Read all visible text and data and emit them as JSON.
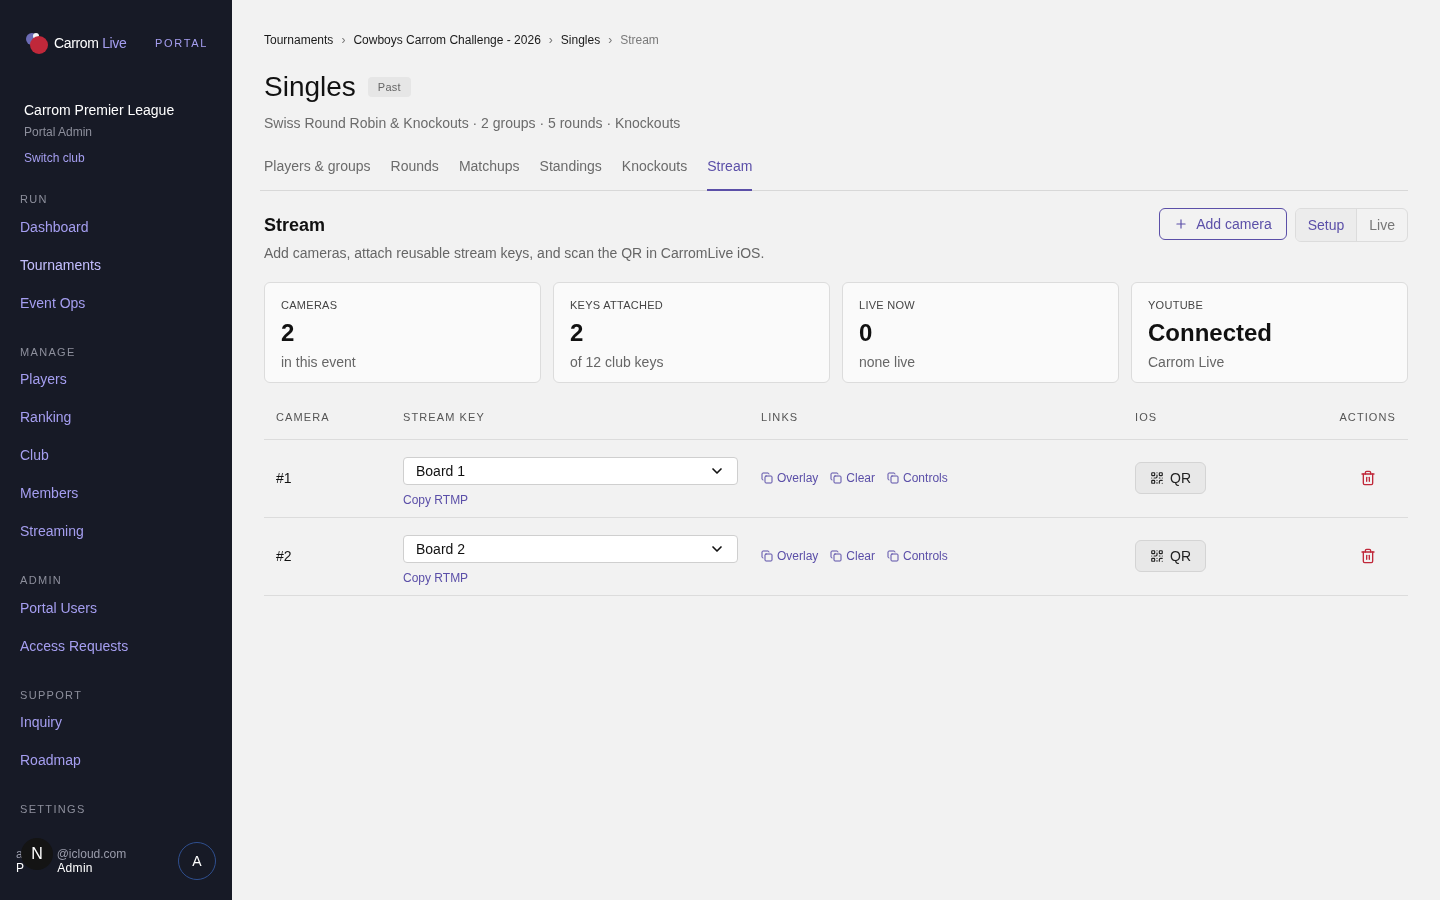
{
  "sidebar": {
    "brand": {
      "name": "Carrom",
      "accent": "Live",
      "tag": "PORTAL"
    },
    "club": {
      "name": "Carrom Premier League",
      "role": "Portal Admin",
      "switch": "Switch club"
    },
    "sections": [
      {
        "title": "RUN",
        "items": [
          {
            "label": "Dashboard",
            "selected": false
          },
          {
            "label": "Tournaments",
            "selected": true
          },
          {
            "label": "Event Ops",
            "selected": false
          }
        ]
      },
      {
        "title": "MANAGE",
        "items": [
          {
            "label": "Players",
            "selected": false
          },
          {
            "label": "Ranking",
            "selected": false
          },
          {
            "label": "Club",
            "selected": false
          },
          {
            "label": "Members",
            "selected": false
          },
          {
            "label": "Streaming",
            "selected": false
          }
        ]
      },
      {
        "title": "ADMIN",
        "items": [
          {
            "label": "Portal Users",
            "selected": false
          },
          {
            "label": "Access Requests",
            "selected": false
          }
        ]
      },
      {
        "title": "SUPPORT",
        "items": [
          {
            "label": "Inquiry",
            "selected": false
          },
          {
            "label": "Roadmap",
            "selected": false
          }
        ]
      },
      {
        "title": "SETTINGS"
      }
    ],
    "user": {
      "email_start": "a",
      "email_end": "@icloud.com",
      "role_start": "P",
      "role_end": "Admin",
      "overlay_initial": "N",
      "avatar_initial": "A"
    }
  },
  "breadcrumbs": [
    {
      "label": "Tournaments",
      "current": false
    },
    {
      "label": "Cowboys Carrom Challenge - 2026",
      "current": false
    },
    {
      "label": "Singles",
      "current": false
    },
    {
      "label": "Stream",
      "current": true
    }
  ],
  "breadcrumb_separator": "›",
  "header": {
    "title": "Singles",
    "badge": "Past",
    "subtitle": "Swiss Round Robin & Knockouts · 2 groups · 5 rounds · Knockouts"
  },
  "tabs": [
    {
      "label": "Players & groups",
      "selected": false
    },
    {
      "label": "Rounds",
      "selected": false
    },
    {
      "label": "Matchups",
      "selected": false
    },
    {
      "label": "Standings",
      "selected": false
    },
    {
      "label": "Knockouts",
      "selected": false
    },
    {
      "label": "Stream",
      "selected": true
    }
  ],
  "stream": {
    "title": "Stream",
    "description": "Add cameras, attach reusable stream keys, and scan the QR in CarromLive iOS.",
    "add_button": "Add camera",
    "modes": [
      {
        "label": "Setup",
        "selected": true
      },
      {
        "label": "Live",
        "selected": false
      }
    ]
  },
  "stats": [
    {
      "label": "CAMERAS",
      "value": "2",
      "note": "in this event"
    },
    {
      "label": "KEYS ATTACHED",
      "value": "2",
      "note": "of 12 club keys"
    },
    {
      "label": "LIVE NOW",
      "value": "0",
      "note": "none live"
    },
    {
      "label": "YOUTUBE",
      "value": "Connected",
      "note": "Carrom Live"
    }
  ],
  "table": {
    "columns": [
      "CAMERA",
      "STREAM KEY",
      "LINKS",
      "IOS",
      "ACTIONS"
    ],
    "rows": [
      {
        "camera": "#1",
        "stream_key": "Board 1",
        "copy": "Copy RTMP",
        "links": [
          "Overlay",
          "Clear",
          "Controls"
        ],
        "qr": "QR"
      },
      {
        "camera": "#2",
        "stream_key": "Board 2",
        "copy": "Copy RTMP",
        "links": [
          "Overlay",
          "Clear",
          "Controls"
        ],
        "qr": "QR"
      }
    ]
  }
}
